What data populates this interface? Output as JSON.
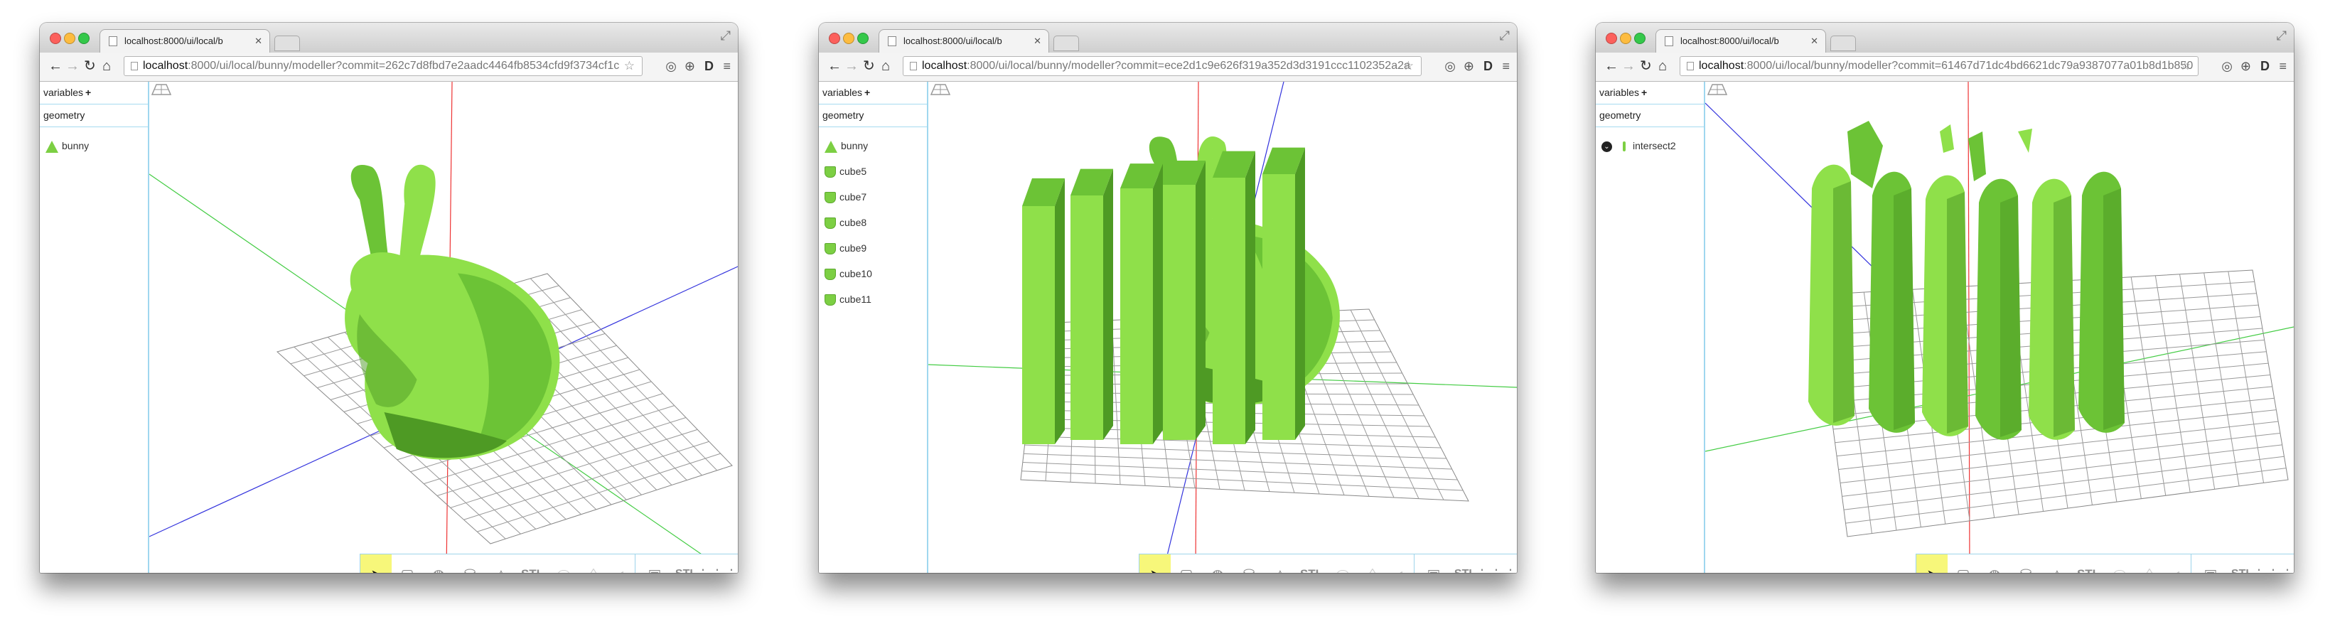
{
  "colors": {
    "model_light": "#8fe04a",
    "model_mid": "#6cc336",
    "model_dark": "#4e9a24",
    "axis_x": "#3333dd",
    "axis_y": "#ee3333",
    "axis_z": "#44cc44",
    "panel_border": "#9fd7ef",
    "pointer_tool_bg": "#f7f77a"
  },
  "windows": [
    {
      "tab_title": "localhost:8000/ui/local/b",
      "url_host": "localhost",
      "url_path": ":8000/ui/local/bunny/modeller?commit=262c7d8fbd7e2aadc4464fb8534cfd9f3734cf1c",
      "sidebar": {
        "variables_label": "variables",
        "variables_add": "+",
        "geometry_label": "geometry",
        "items": [
          {
            "icon": "cone-icon",
            "label": "bunny"
          }
        ]
      },
      "scene": "bunny"
    },
    {
      "tab_title": "localhost:8000/ui/local/b",
      "url_host": "localhost",
      "url_path": ":8000/ui/local/bunny/modeller?commit=ece2d1c9e626f319a352d3d3191ccc1102352a2a",
      "sidebar": {
        "variables_label": "variables",
        "variables_add": "+",
        "geometry_label": "geometry",
        "items": [
          {
            "icon": "cone-icon",
            "label": "bunny"
          },
          {
            "icon": "cube-icon",
            "label": "cube5"
          },
          {
            "icon": "cube-icon",
            "label": "cube7"
          },
          {
            "icon": "cube-icon",
            "label": "cube8"
          },
          {
            "icon": "cube-icon",
            "label": "cube9"
          },
          {
            "icon": "cube-icon",
            "label": "cube10"
          },
          {
            "icon": "cube-icon",
            "label": "cube11"
          }
        ]
      },
      "scene": "slabs"
    },
    {
      "tab_title": "localhost:8000/ui/local/b",
      "url_host": "localhost",
      "url_path": ":8000/ui/local/bunny/modeller?commit=61467d71dc4bd6621dc79a9387077a01b8d1b850",
      "sidebar": {
        "variables_label": "variables",
        "variables_add": "+",
        "geometry_label": "geometry",
        "items": [
          {
            "icon": "chevron-down-icon",
            "label": "intersect2"
          }
        ]
      },
      "scene": "intersect"
    }
  ],
  "toolbar_panel": {
    "tools": [
      {
        "name": "pointer-tool",
        "glyph": "➤"
      },
      {
        "name": "cube-tool",
        "glyph": "▢"
      },
      {
        "name": "sphere-tool",
        "glyph": "◍"
      },
      {
        "name": "cylinder-tool",
        "glyph": "⛁"
      },
      {
        "name": "cone-tool",
        "glyph": "△"
      },
      {
        "name": "import-stl-tool",
        "glyph": "STL"
      },
      {
        "name": "oval-tool",
        "glyph": "⬭"
      },
      {
        "name": "lens-tool",
        "glyph": "◊"
      },
      {
        "name": "half-tool",
        "glyph": "◐"
      },
      {
        "name": "save-tool",
        "glyph": "▣"
      },
      {
        "name": "export-stl-tool",
        "glyph": "STL"
      },
      {
        "name": "grid-tool",
        "glyph": "⋮⋮⋮"
      },
      {
        "name": "help-tool",
        "glyph": "?"
      }
    ]
  }
}
